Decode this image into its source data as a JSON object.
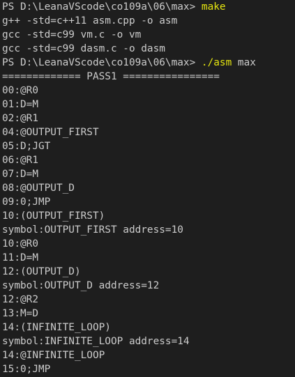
{
  "terminal": {
    "lines": [
      {
        "prompt": "PS D:\\LeanaVScode\\co109a\\06\\max> ",
        "command": "make",
        "args": ""
      },
      {
        "text": "g++ -std=c++11 asm.cpp -o asm"
      },
      {
        "text": "gcc -std=c99 vm.c -o vm"
      },
      {
        "text": "gcc -std=c99 dasm.c -o dasm"
      },
      {
        "prompt": "PS D:\\LeanaVScode\\co109a\\06\\max> ",
        "command": "./asm",
        "args": " max"
      },
      {
        "text": "============= PASS1 ================"
      },
      {
        "text": "00:@R0"
      },
      {
        "text": "01:D=M"
      },
      {
        "text": "02:@R1"
      },
      {
        "text": "04:@OUTPUT_FIRST"
      },
      {
        "text": "05:D;JGT"
      },
      {
        "text": "06:@R1"
      },
      {
        "text": "07:D=M"
      },
      {
        "text": "08:@OUTPUT_D"
      },
      {
        "text": "09:0;JMP"
      },
      {
        "text": "10:(OUTPUT_FIRST)"
      },
      {
        "text": "symbol:OUTPUT_FIRST address=10"
      },
      {
        "text": "10:@R0"
      },
      {
        "text": "11:D=M"
      },
      {
        "text": "12:(OUTPUT_D)"
      },
      {
        "text": "symbol:OUTPUT_D address=12"
      },
      {
        "text": "12:@R2"
      },
      {
        "text": "13:M=D"
      },
      {
        "text": "14:(INFINITE_LOOP)"
      },
      {
        "text": "symbol:INFINITE_LOOP address=14"
      },
      {
        "text": "14:@INFINITE_LOOP"
      },
      {
        "text": "15:0;JMP"
      }
    ]
  },
  "colors": {
    "background": "#1e1e1e",
    "text": "#cccccc",
    "command": "#e5e510"
  }
}
